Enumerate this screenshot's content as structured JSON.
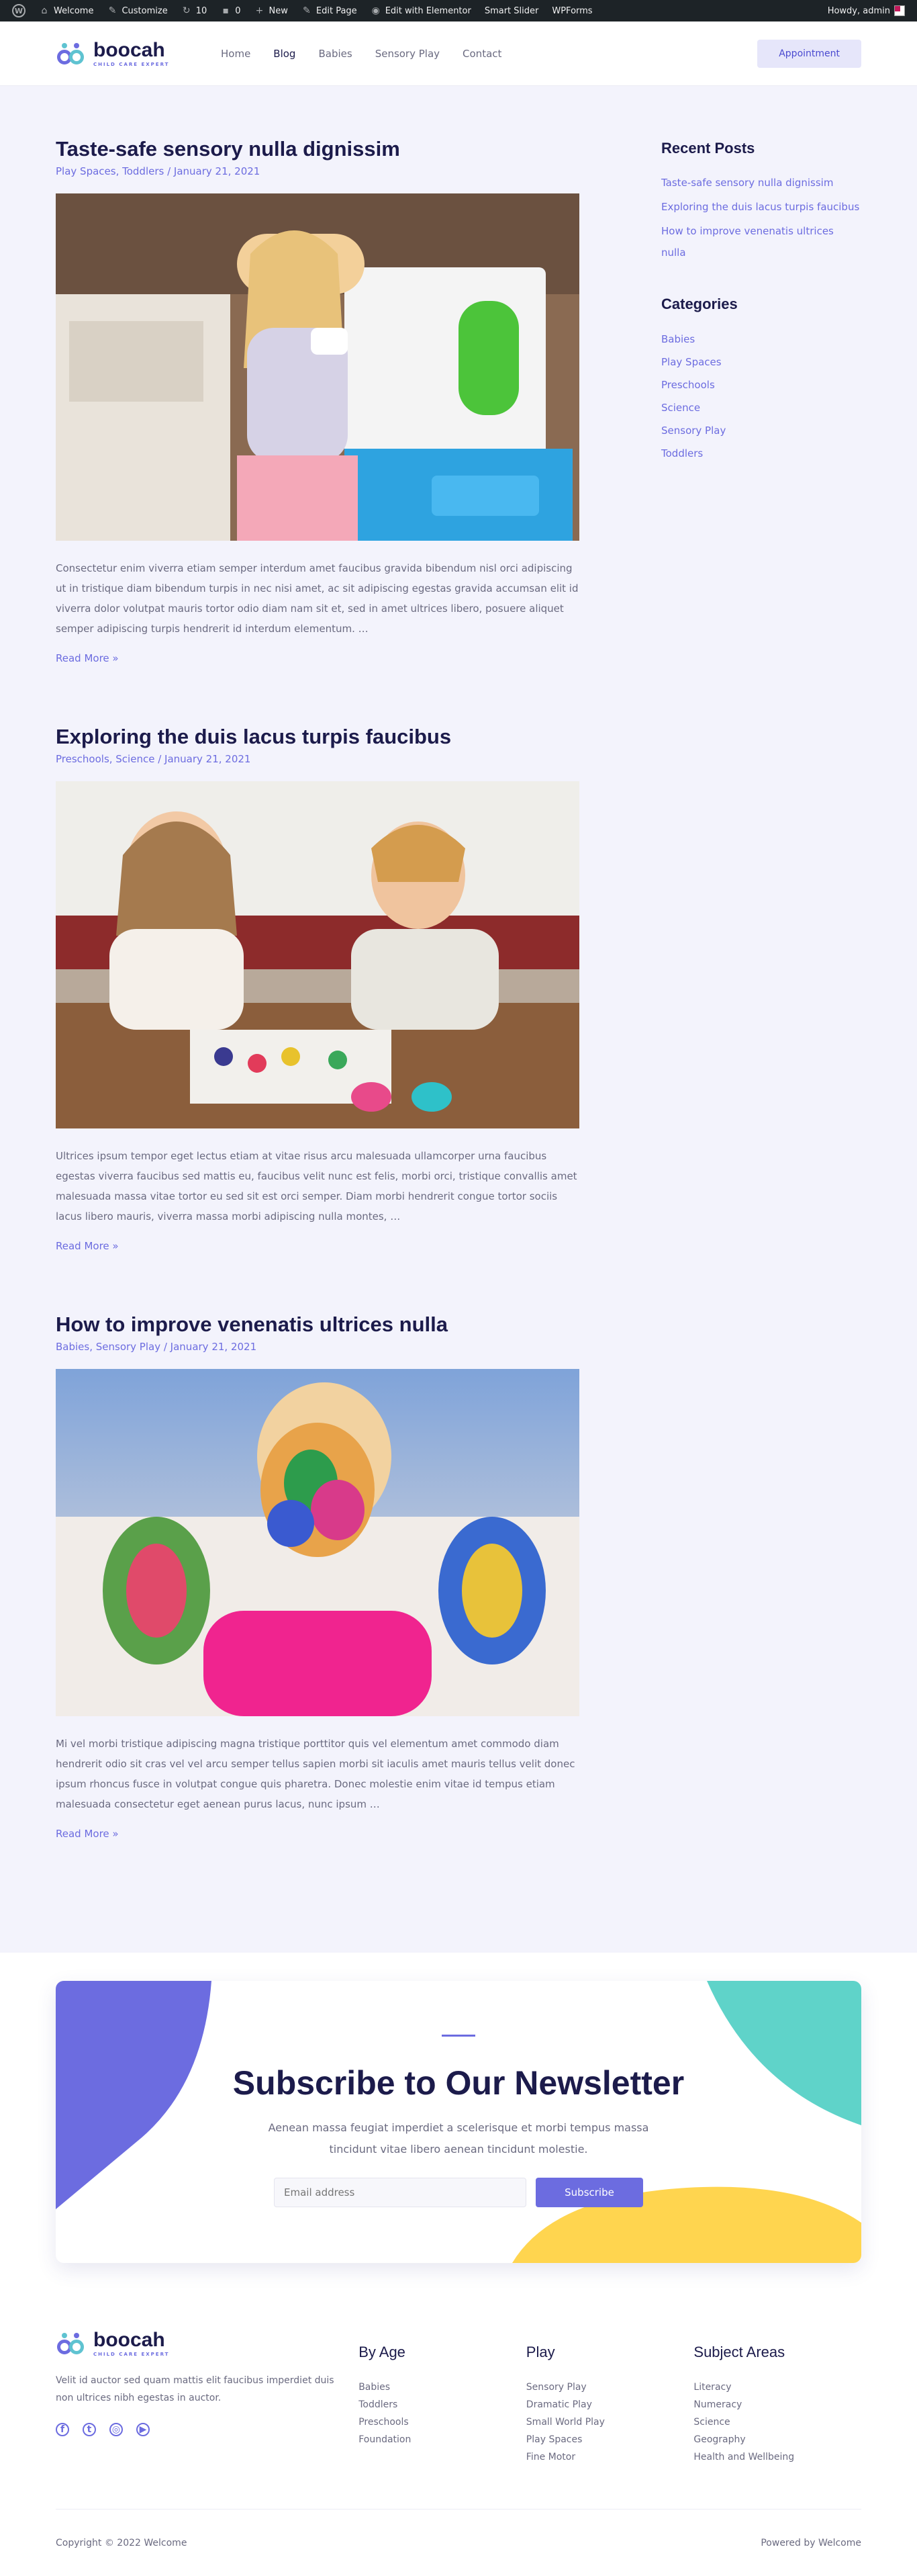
{
  "admin_bar": {
    "site_name": "Welcome",
    "customize": "Customize",
    "updates": "10",
    "comments": "0",
    "new": "New",
    "edit_page": "Edit Page",
    "elementor": "Edit with Elementor",
    "slider": "Smart Slider",
    "wpforms": "WPForms",
    "greeting": "Howdy, admin"
  },
  "header": {
    "logo_name": "boocah",
    "logo_tagline": "CHILD CARE EXPERT",
    "nav": [
      "Home",
      "Blog",
      "Babies",
      "Sensory Play",
      "Contact"
    ],
    "active_nav": "Blog",
    "cta": "Appointment"
  },
  "posts": [
    {
      "title": "Taste-safe sensory nulla dignissim",
      "meta": "Play Spaces, Toddlers / January 21, 2021",
      "excerpt": "Consectetur enim viverra etiam semper interdum amet faucibus gravida bibendum nisl orci adipiscing ut in tristique diam bibendum turpis in nec nisi amet, ac sit adipiscing egestas gravida accumsan elit id viverra dolor volutpat mauris tortor odio diam nam sit et, sed in amet ultrices libero, posuere aliquet semper adipiscing turpis hendrerit id interdum elementum. …",
      "read_more": "Read More »"
    },
    {
      "title": "Exploring the duis lacus turpis faucibus",
      "meta": "Preschools, Science / January 21, 2021",
      "excerpt": "Ultrices ipsum tempor eget lectus etiam at vitae risus arcu malesuada ullamcorper urna faucibus egestas viverra faucibus sed mattis eu, faucibus velit nunc est felis, morbi orci, tristique convallis amet malesuada massa vitae tortor eu sed sit est orci semper. Diam morbi hendrerit congue tortor sociis lacus libero mauris, viverra massa morbi adipiscing nulla montes, …",
      "read_more": "Read More »"
    },
    {
      "title": "How to improve venenatis ultrices nulla",
      "meta": "Babies, Sensory Play / January 21, 2021",
      "excerpt": "Mi vel morbi tristique adipiscing magna tristique porttitor quis vel elementum amet commodo diam hendrerit odio sit cras vel vel arcu semper tellus sapien morbi sit iaculis amet mauris tellus velit donec ipsum rhoncus fusce in volutpat congue quis pharetra. Donec molestie enim vitae id tempus etiam malesuada consectetur eget aenean purus lacus, nunc ipsum …",
      "read_more": "Read More »"
    }
  ],
  "sidebar": {
    "recent_title": "Recent Posts",
    "recent": [
      "Taste-safe sensory nulla dignissim",
      "Exploring the duis lacus turpis faucibus",
      "How to improve venenatis ultrices nulla"
    ],
    "categories_title": "Categories",
    "categories": [
      "Babies",
      "Play Spaces",
      "Preschools",
      "Science",
      "Sensory Play",
      "Toddlers"
    ]
  },
  "newsletter": {
    "title": "Subscribe to Our Newsletter",
    "subtitle": "Aenean massa feugiat imperdiet a scelerisque et morbi tempus massa tincidunt vitae libero aenean tincidunt molestie.",
    "placeholder": "Email address",
    "button": "Subscribe"
  },
  "footer": {
    "about": "Velit id auctor sed quam mattis elit faucibus imperdiet duis non ultrices nibh egestas in auctor.",
    "columns": [
      {
        "title": "By Age",
        "links": [
          "Babies",
          "Toddlers",
          "Preschools",
          "Foundation"
        ]
      },
      {
        "title": "Play",
        "links": [
          "Sensory Play",
          "Dramatic Play",
          "Small World Play",
          "Play Spaces",
          "Fine Motor"
        ]
      },
      {
        "title": "Subject Areas",
        "links": [
          "Literacy",
          "Numeracy",
          "Science",
          "Geography",
          "Health and Wellbeing"
        ]
      }
    ],
    "copyright": "Copyright © 2022 Welcome",
    "powered": "Powered by Welcome"
  },
  "colors": {
    "accent": "#6c6ce0",
    "teal": "#5fd3c9",
    "yellow": "#ffd54f",
    "heading": "#1c1b4b"
  }
}
